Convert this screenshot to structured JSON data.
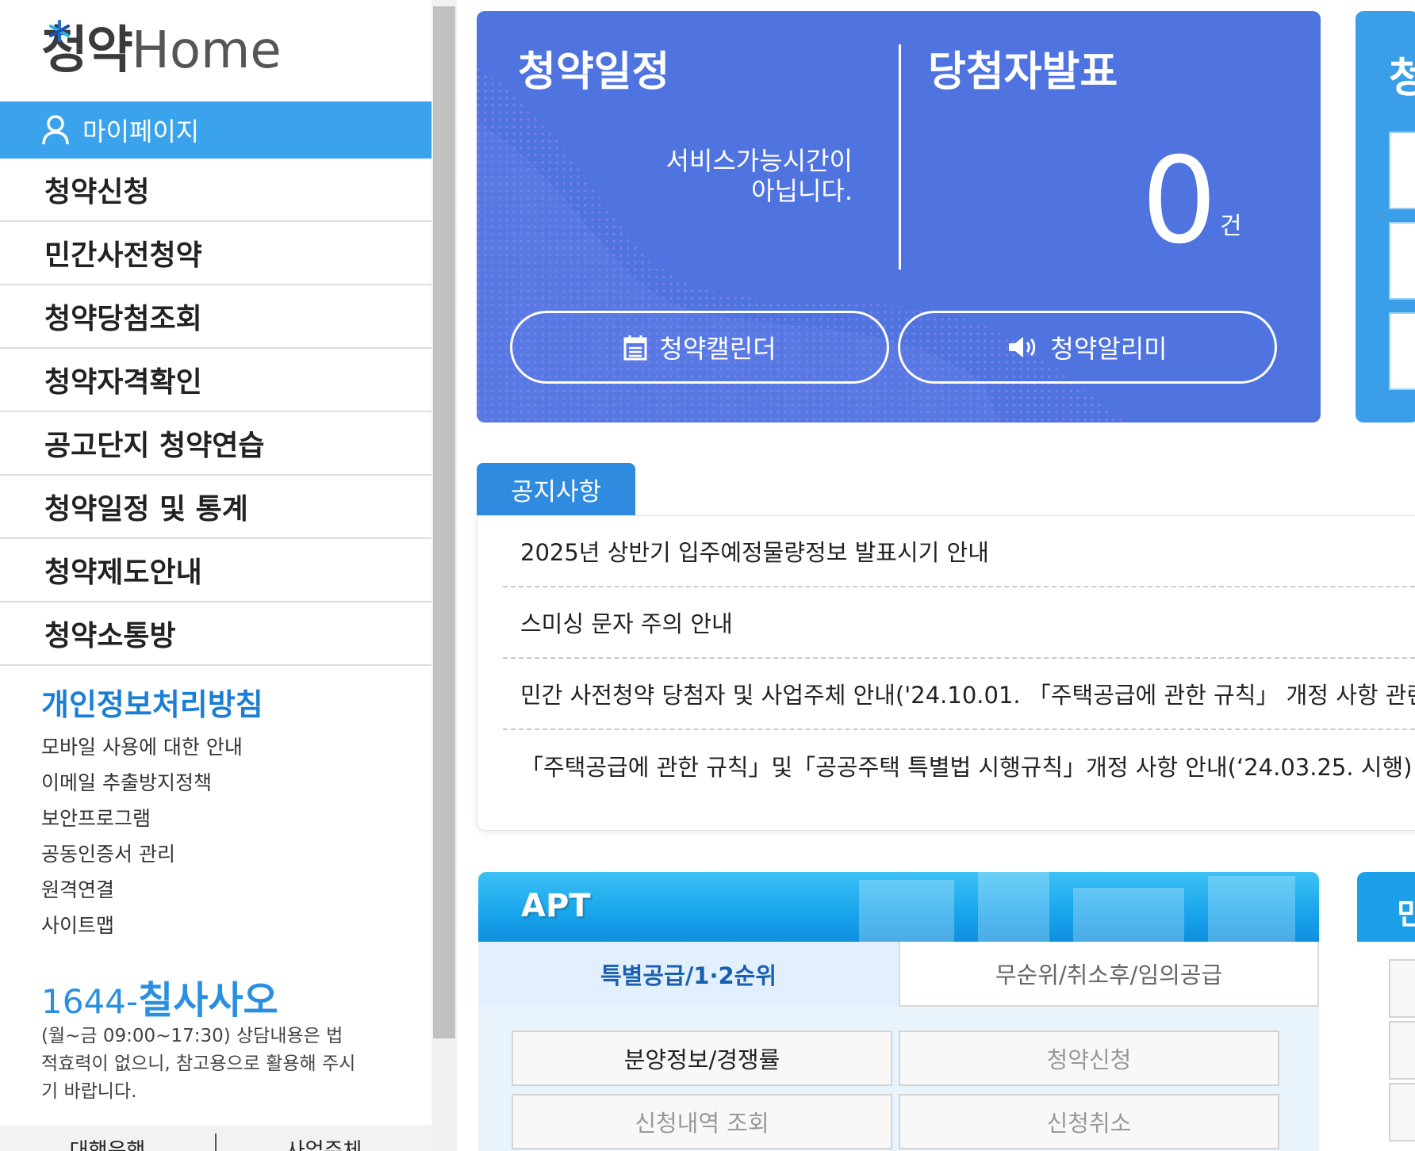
{
  "logo": {
    "text_main": "청약",
    "text_home": "Home"
  },
  "sidebar": {
    "mypage_label": "마이페이지",
    "nav_items": [
      {
        "label": "청약신청"
      },
      {
        "label": "민간사전청약"
      },
      {
        "label": "청약당첨조회"
      },
      {
        "label": "청약자격확인"
      },
      {
        "label": "공고단지 청약연습"
      },
      {
        "label": "청약일정 및 통계"
      },
      {
        "label": "청약제도안내"
      },
      {
        "label": "청약소통방"
      }
    ],
    "privacy_policy": "개인정보처리방침",
    "links": [
      "모바일 사용에 대한 안내",
      "이메일 추출방지정책",
      "보안프로그램",
      "공동인증서 관리",
      "원격연결",
      "사이트맵"
    ],
    "phone_prefix": "1644-",
    "phone_name": "칠사사오",
    "hours_note": "(월~금 09:00~17:30) 상담내용은 법적효력이 없으니, 참고용으로 활용해 주시기 바랍니다.",
    "bottom_links": [
      "대행은행",
      "사업주체"
    ]
  },
  "hero": {
    "schedule_title": "청약일정",
    "schedule_message_line1": "서비스가능시간이",
    "schedule_message_line2": "아닙니다.",
    "winner_title": "당첨자발표",
    "winner_count": "0",
    "winner_unit": "건",
    "calendar_button": "청약캘린더",
    "alert_button": "청약알리미",
    "calendar_icon": "calendar-icon",
    "alert_icon": "speaker-icon"
  },
  "side_card": {
    "title_partial": "청"
  },
  "notices": {
    "tab_label": "공지사항",
    "items": [
      "2025년 상반기 입주예정물량정보 발표시기 안내",
      "스미싱 문자 주의 안내",
      "민간 사전청약 당첨자 및 사업주체 안내('24.10.01. 「주택공급에 관한 규칙」 개정 사항 관련)",
      "「주택공급에 관한 규칙」및「공공주택 특별법 시행규칙」개정 사항 안내(‘24.03.25. 시행)"
    ]
  },
  "apt": {
    "title": "APT",
    "tab_active": "특별공급/1·2순위",
    "tab_inactive": "무순위/취소후/임의공급",
    "buttons": [
      "분양정보/경쟁률",
      "청약신청",
      "신청내역 조회",
      "신청취소"
    ]
  },
  "min_card": {
    "title_partial": "민"
  },
  "colors": {
    "hero_bg": "#4f74e0",
    "mypage_bg": "#3aa3ec",
    "accent_blue": "#2e8be0",
    "privacy_text": "#1a7fd4"
  }
}
